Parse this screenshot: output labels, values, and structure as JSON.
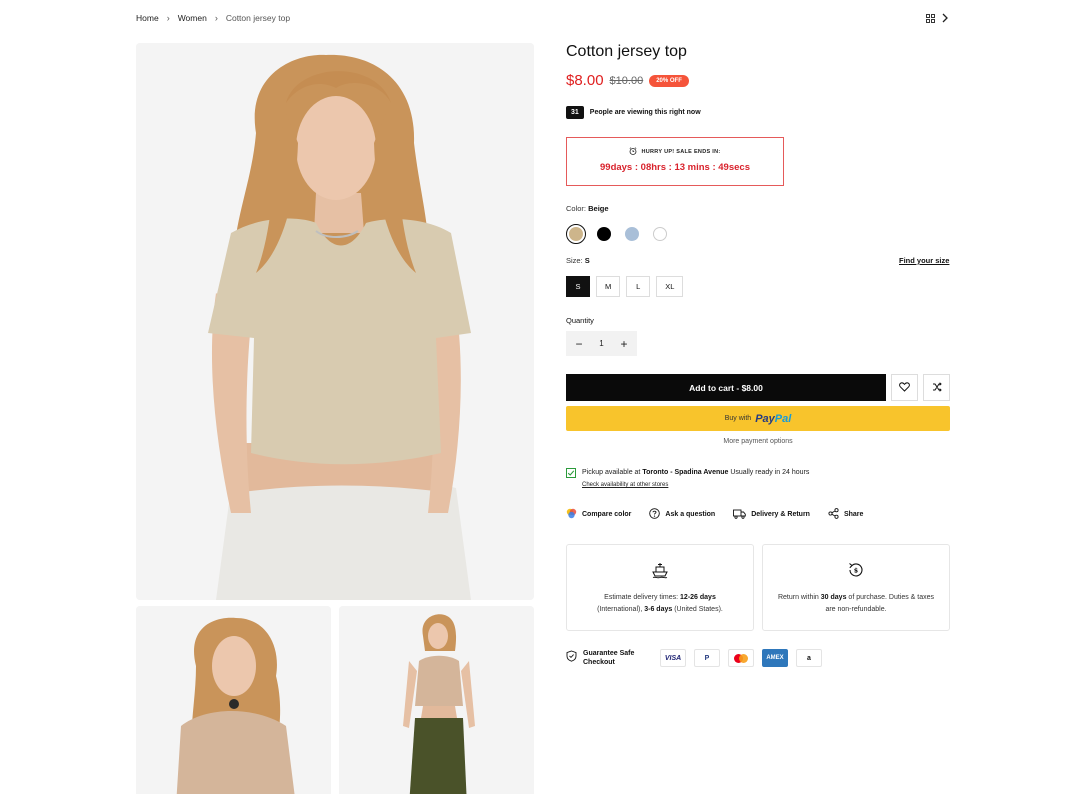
{
  "breadcrumb": {
    "home": "Home",
    "category": "Women",
    "current": "Cotton jersey top"
  },
  "product": {
    "title": "Cotton jersey top",
    "price": "$8.00",
    "old_price": "$10.00",
    "discount": "20% OFF",
    "viewers_count": "31",
    "viewers_text": "People are viewing this right now"
  },
  "countdown": {
    "label": "HURRY UP! SALE ENDS IN:",
    "time": "99days : 08hrs : 13 mins : 49secs"
  },
  "color": {
    "label": "Color:",
    "selected": "Beige",
    "options": [
      {
        "name": "Beige",
        "hex": "#cdb58b"
      },
      {
        "name": "Black",
        "hex": "#000000"
      },
      {
        "name": "Light Blue",
        "hex": "#a9bfd8"
      },
      {
        "name": "White",
        "hex": "#ffffff"
      }
    ]
  },
  "size": {
    "label": "Size:",
    "selected": "S",
    "find_size": "Find your size",
    "options": [
      "S",
      "M",
      "L",
      "XL"
    ]
  },
  "quantity": {
    "label": "Quantity",
    "value": "1",
    "minus": "−",
    "plus": "+"
  },
  "cart": {
    "add_label": "Add to cart - $8.00",
    "paypal_prefix": "Buy with",
    "paypal_brand_1": "Pay",
    "paypal_brand_2": "Pal",
    "more_payment": "More payment options"
  },
  "pickup": {
    "prefix": "Pickup available at",
    "location": "Toronto - Spadina Avenue",
    "suffix": "Usually ready in 24 hours",
    "link": "Check availability at other stores"
  },
  "actions": [
    {
      "label": "Compare color",
      "icon": "color-palette-icon"
    },
    {
      "label": "Ask a question",
      "icon": "question-icon"
    },
    {
      "label": "Delivery & Return",
      "icon": "truck-icon"
    },
    {
      "label": "Share",
      "icon": "share-icon"
    }
  ],
  "delivery": {
    "t1": "Estimate delivery times:",
    "b1": "12-26 days",
    "t2": "(International),",
    "b2": "3-6 days",
    "t3": "(United States)."
  },
  "returns": {
    "t1": "Return within",
    "b1": "30 days",
    "t2": "of purchase. Duties & taxes are non-refundable."
  },
  "guarantee": {
    "label": "Guarantee Safe Checkout",
    "payments": [
      "VISA",
      "P",
      "mastercard",
      "AMEX",
      "a"
    ]
  },
  "colors": {
    "accent_red": "#e02020",
    "badge": "#f5543a",
    "paypal_yellow": "#f8c42c",
    "check_green": "#2b9b3b"
  }
}
